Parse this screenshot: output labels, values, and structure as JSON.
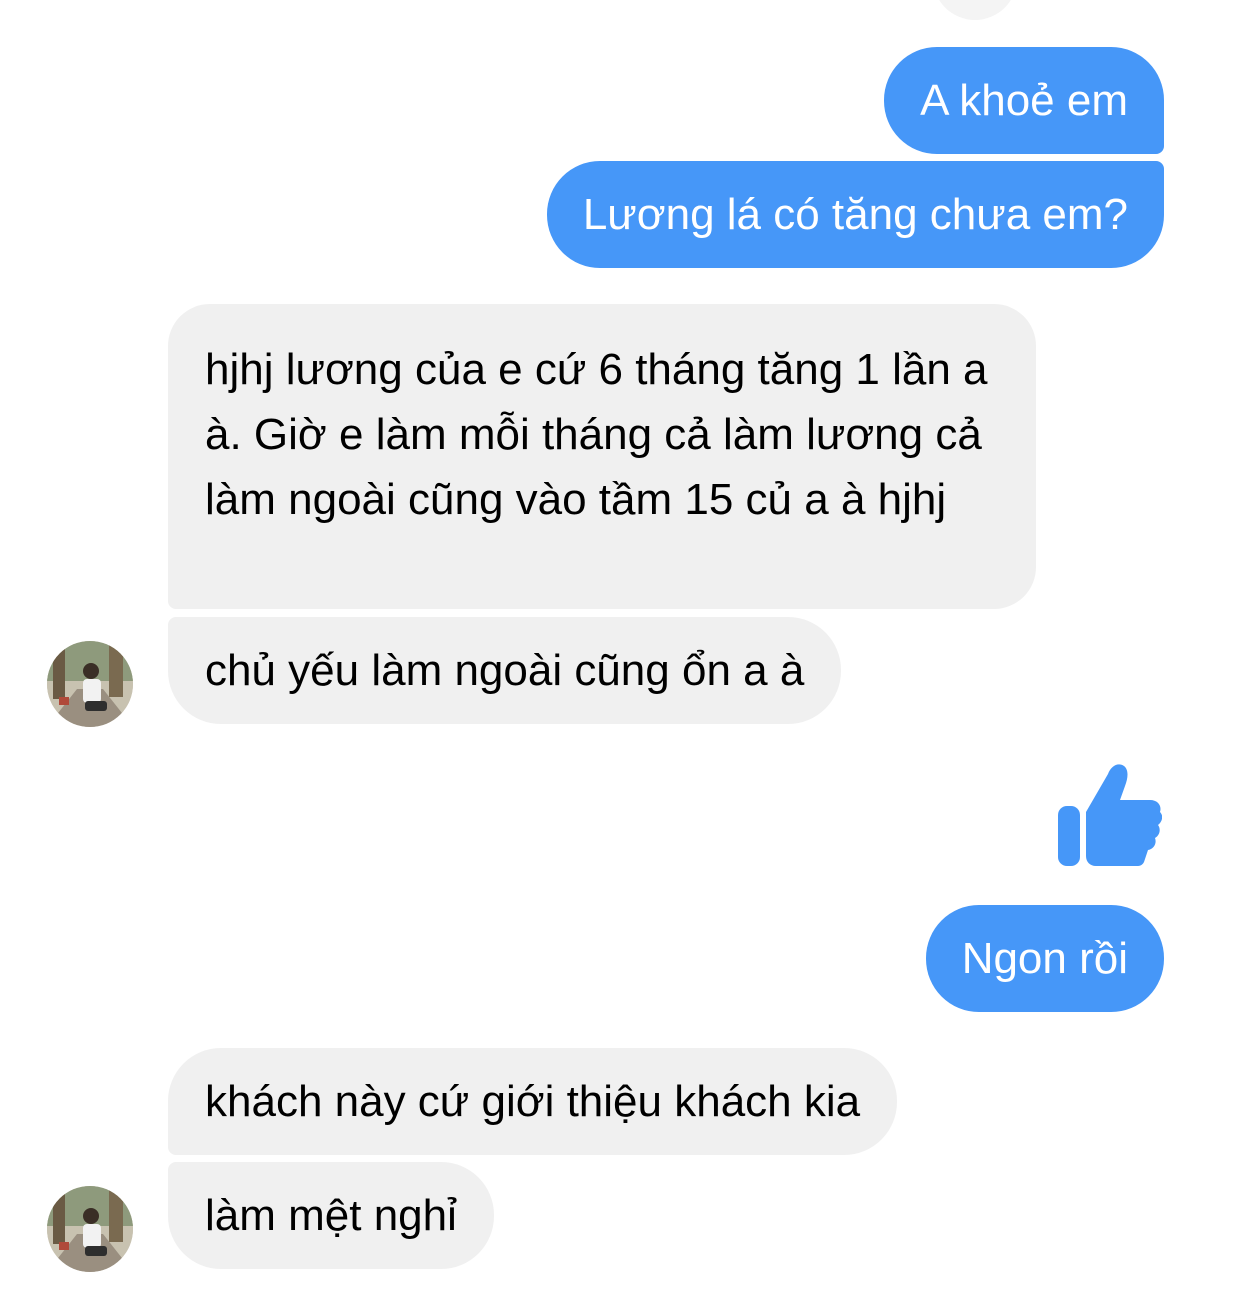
{
  "conversation": {
    "messages": [
      {
        "sender": "me",
        "type": "reaction",
        "icon": "thumbs-up-icon",
        "color": "#f5a623"
      },
      {
        "sender": "me",
        "type": "text",
        "text": "A khoẻ em"
      },
      {
        "sender": "me",
        "type": "text",
        "text": "Lương lá có tăng chưa em?"
      },
      {
        "sender": "contact",
        "type": "text",
        "text": "hjhj lương của e cứ 6 tháng tăng 1 lần a à. Giờ e làm mỗi tháng cả làm lương cả làm ngoài cũng vào tầm 15 củ a à hjhj"
      },
      {
        "sender": "contact",
        "type": "text",
        "text": "chủ yếu làm ngoài cũng ổn a à"
      },
      {
        "sender": "me",
        "type": "sticker",
        "icon": "thumbs-up-icon",
        "color": "#4697f8"
      },
      {
        "sender": "me",
        "type": "text",
        "text": "Ngon rồi"
      },
      {
        "sender": "contact",
        "type": "text",
        "text": "khách này cứ giới thiệu khách kia"
      },
      {
        "sender": "contact",
        "type": "text",
        "text": "làm mệt nghỉ"
      }
    ]
  },
  "colors": {
    "outgoing_bubble": "#4697f8",
    "incoming_bubble": "#f0f0f0",
    "outgoing_text": "#ffffff",
    "incoming_text": "#000000",
    "background": "#ffffff"
  }
}
